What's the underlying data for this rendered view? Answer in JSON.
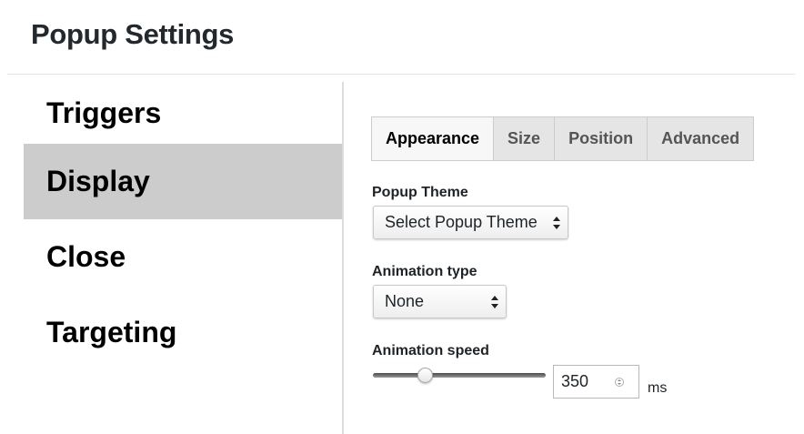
{
  "page": {
    "title": "Popup Settings"
  },
  "sidebar": {
    "items": [
      {
        "label": "Triggers",
        "active": false
      },
      {
        "label": "Display",
        "active": true
      },
      {
        "label": "Close",
        "active": false
      },
      {
        "label": "Targeting",
        "active": false
      }
    ]
  },
  "tabs": [
    {
      "label": "Appearance",
      "active": true
    },
    {
      "label": "Size",
      "active": false
    },
    {
      "label": "Position",
      "active": false
    },
    {
      "label": "Advanced",
      "active": false
    }
  ],
  "fields": {
    "theme": {
      "label": "Popup Theme",
      "value": "Select Popup Theme"
    },
    "animation_type": {
      "label": "Animation type",
      "value": "None"
    },
    "animation_speed": {
      "label": "Animation speed",
      "value": "350",
      "unit": "ms",
      "slider_fraction": 0.3
    }
  },
  "icons": {
    "select_arrows": "up-down-chevron-icon",
    "spin_buttons": "spinner-icon"
  }
}
